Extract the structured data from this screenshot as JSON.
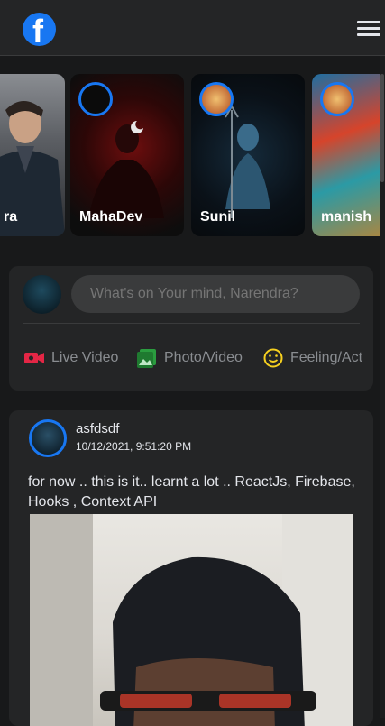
{
  "header": {
    "logo_icon": "facebook-logo-icon",
    "logo_letter": "f",
    "menu_icon": "hamburger-menu-icon",
    "brand_color": "#1877f2"
  },
  "stories": [
    {
      "name": "ra"
    },
    {
      "name": "MahaDev"
    },
    {
      "name": "Sunil"
    },
    {
      "name": "manish"
    }
  ],
  "composer": {
    "placeholder": "What's on Your mind, Narendra?",
    "actions": [
      {
        "label": "Live Video",
        "icon": "live-video-icon",
        "color": "#e42645"
      },
      {
        "label": "Photo/Video",
        "icon": "photo-icon",
        "color": "#2a9d3f"
      },
      {
        "label": "Feeling/Act",
        "icon": "smiley-icon",
        "color": "#f7d11f"
      }
    ]
  },
  "post": {
    "author": "asfdsdf",
    "timestamp": "10/12/2021, 9:51:20 PM",
    "text": "for now .. this is it.. learnt a lot .. ReactJs, Firebase, Hooks , Context API"
  }
}
